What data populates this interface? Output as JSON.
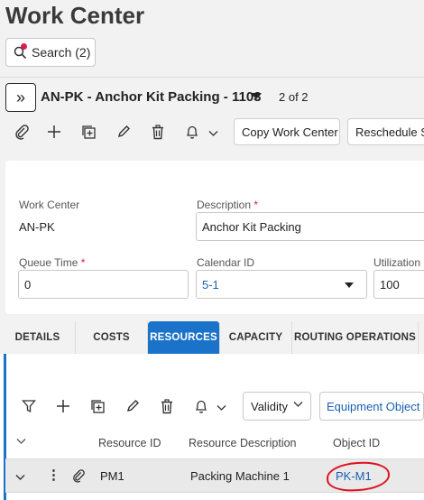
{
  "page": {
    "title": "Work Center"
  },
  "search": {
    "label": "Search (2)"
  },
  "record": {
    "title": "AN-PK - Anchor Kit Packing - 1103",
    "pager": "2 of 2"
  },
  "toolbar": {
    "copy_label": "Copy Work Center",
    "reschedule_label": "Reschedule Sh"
  },
  "form": {
    "work_center": {
      "label": "Work Center",
      "value": "AN-PK"
    },
    "description": {
      "label": "Description",
      "required_mark": "*",
      "value": "Anchor Kit Packing"
    },
    "queue_time": {
      "label": "Queue Time",
      "required_mark": "*",
      "value": "0"
    },
    "calendar_id": {
      "label": "Calendar ID",
      "value": "5-1"
    },
    "utilization": {
      "label": "Utilization",
      "value": "100"
    }
  },
  "tabs": [
    {
      "label": "DETAILS",
      "active": false
    },
    {
      "label": "COSTS",
      "active": false
    },
    {
      "label": "RESOURCES",
      "active": true
    },
    {
      "label": "CAPACITY",
      "active": false
    },
    {
      "label": "ROUTING OPERATIONS",
      "active": false
    }
  ],
  "resources": {
    "filter_select": "Validity",
    "equipment_button": "Equipment Object",
    "columns": [
      "Resource ID",
      "Resource Description",
      "Object ID"
    ],
    "rows": [
      {
        "resource_id": "PM1",
        "description": "Packing Machine 1",
        "object_id": "PK-M1"
      }
    ]
  },
  "colors": {
    "accent": "#1a73c8",
    "required": "#d6204f",
    "link": "#1a5fb4",
    "annotation": "#e0101e"
  }
}
